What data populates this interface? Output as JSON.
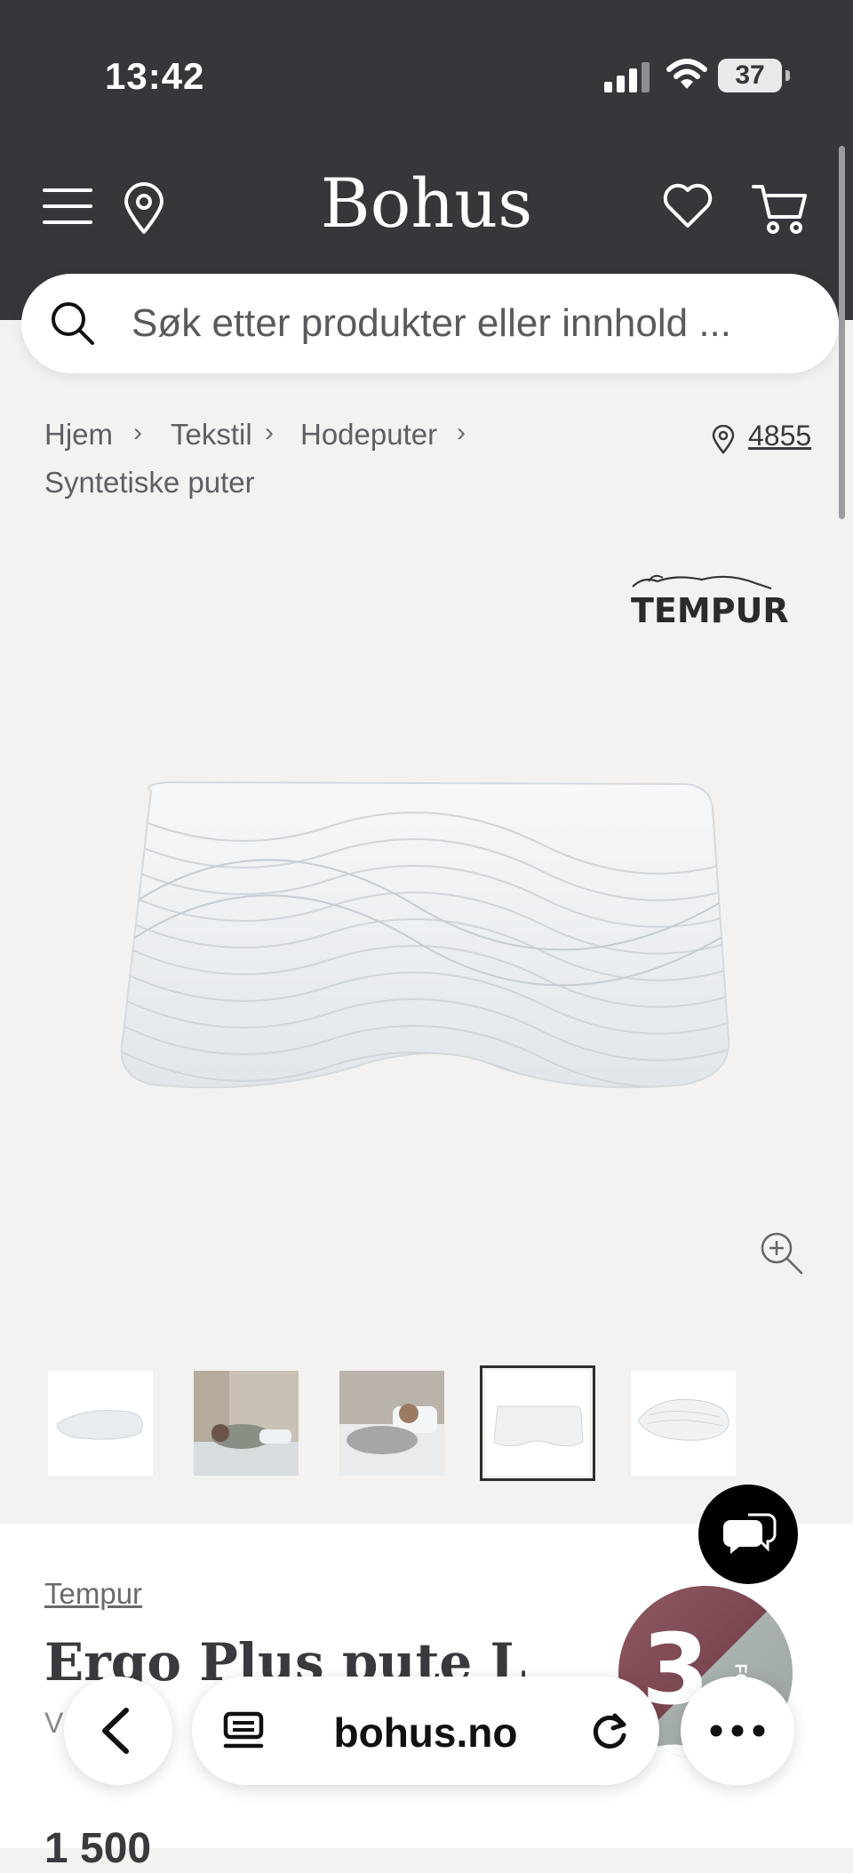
{
  "status_bar": {
    "time": "13:42",
    "battery": "37"
  },
  "header": {
    "logo": "Bohus"
  },
  "search": {
    "placeholder": "Søk etter produkter eller innhold ..."
  },
  "breadcrumb": {
    "items": [
      "Hjem",
      "Tekstil",
      "Hodeputer",
      "Syntetiske puter"
    ],
    "store": "4855"
  },
  "product": {
    "brand_logo": "TEMPUR",
    "brand": "Tempur",
    "title": "Ergo Plus pute L",
    "variant_text": "V    me",
    "price": "1 500"
  },
  "promo": {
    "number": "3 2",
    "text": "FOR"
  },
  "browser": {
    "url": "bohus.no"
  },
  "colors": {
    "header_bg": "#36363b",
    "page_bg": "#f4f2f0",
    "text": "#3a393d"
  },
  "icons": [
    "menu-icon",
    "location-pin-icon",
    "heart-icon",
    "cart-icon",
    "search-icon",
    "zoom-in-icon",
    "chat-icon",
    "back-icon",
    "tabs-icon",
    "reload-icon",
    "more-icon"
  ]
}
